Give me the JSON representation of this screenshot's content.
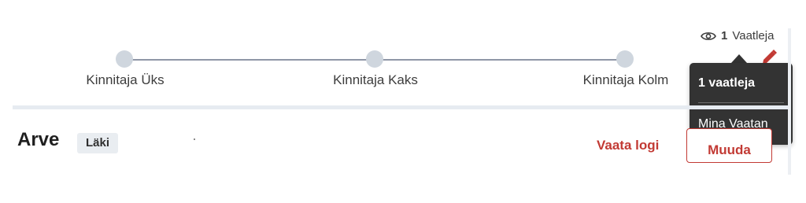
{
  "steps": [
    {
      "label": "Kinnitaja Üks"
    },
    {
      "label": "Kinnitaja Kaks"
    },
    {
      "label": "Kinnitaja Kolm"
    }
  ],
  "viewers": {
    "count": "1",
    "label": "Vaatleja"
  },
  "tooltip": {
    "title": "1 vaatleja",
    "items": [
      "Mina Vaatan"
    ]
  },
  "invoice": {
    "title": "Arve",
    "badge": "Läki"
  },
  "actions": {
    "view_log": "Vaata logi",
    "edit": "Muuda"
  },
  "colors": {
    "accent": "#c23a34",
    "step_dot": "#cfd6de",
    "step_line": "#8f96a6",
    "tooltip_bg": "#333333"
  },
  "icons": {
    "viewers": "eye-icon",
    "edit": "pencil-icon"
  }
}
